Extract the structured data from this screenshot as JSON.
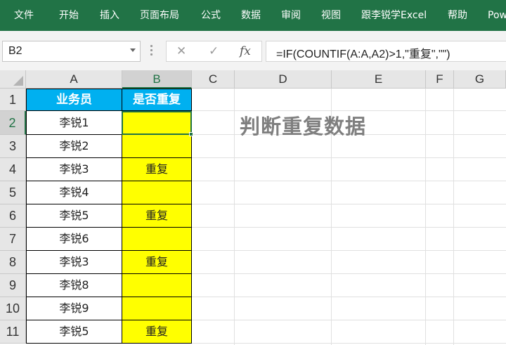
{
  "ribbon": {
    "tabs": [
      "文件",
      "开始",
      "插入",
      "页面布局",
      "公式",
      "数据",
      "审阅",
      "视图",
      "跟李锐学Excel",
      "帮助",
      "Pow"
    ]
  },
  "formula_bar": {
    "name_box": "B2",
    "cancel_icon": "✕",
    "enter_icon": "✓",
    "fx_label": "fx",
    "formula": "=IF(COUNTIF(A:A,A2)>1,\"重复\",\"\")"
  },
  "columns": [
    "A",
    "B",
    "C",
    "D",
    "E",
    "F",
    "G"
  ],
  "rows": [
    "1",
    "2",
    "3",
    "4",
    "5",
    "6",
    "7",
    "8",
    "9",
    "10",
    "11"
  ],
  "table": {
    "headers": [
      "业务员",
      "是否重复"
    ],
    "col_a": [
      "李锐1",
      "李锐2",
      "李锐3",
      "李锐4",
      "李锐5",
      "李锐6",
      "李锐3",
      "李锐8",
      "李锐9",
      "李锐5"
    ],
    "col_b": [
      "",
      "",
      "重复",
      "",
      "重复",
      "",
      "重复",
      "",
      "",
      "重复"
    ]
  },
  "sheet_title": "判断重复数据",
  "colors": {
    "ribbon": "#217346",
    "header_fill": "#00b0f0",
    "highlight_fill": "#ffff00",
    "title_text": "#7f7f7f"
  },
  "selection": {
    "active_cell": "B2",
    "active_column": "B",
    "active_row": "2"
  }
}
